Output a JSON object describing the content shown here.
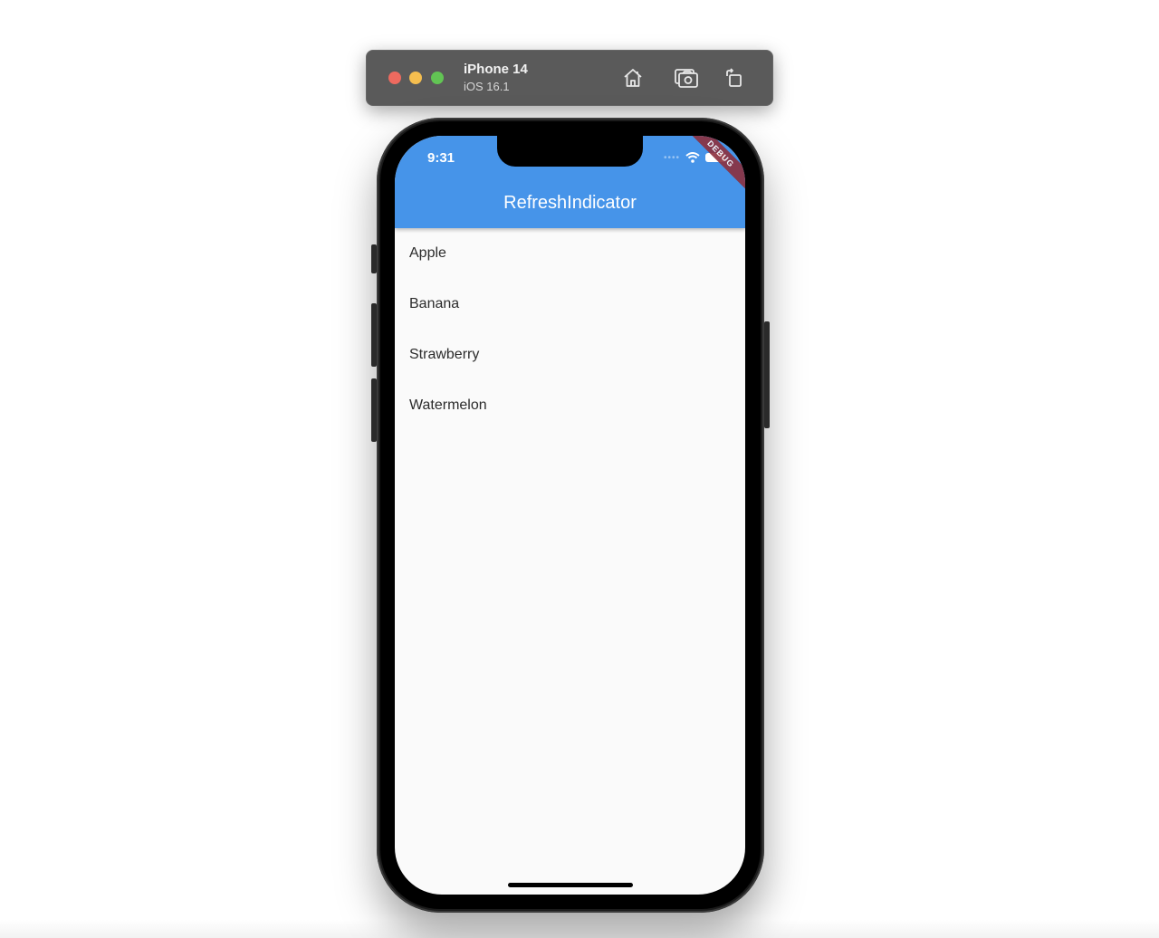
{
  "simulator": {
    "device_name": "iPhone 14",
    "os_version": "iOS 16.1",
    "toolbar_icons": [
      "home-icon",
      "screenshot-icon",
      "rotate-icon"
    ]
  },
  "status_bar": {
    "time": "9:31",
    "icons": [
      "signal-icon",
      "wifi-icon",
      "battery-icon"
    ]
  },
  "debug_banner": "DEBUG",
  "app_bar": {
    "title": "RefreshIndicator",
    "color": "#4694e9"
  },
  "list": {
    "items": [
      "Apple",
      "Banana",
      "Strawberry",
      "Watermelon"
    ]
  }
}
